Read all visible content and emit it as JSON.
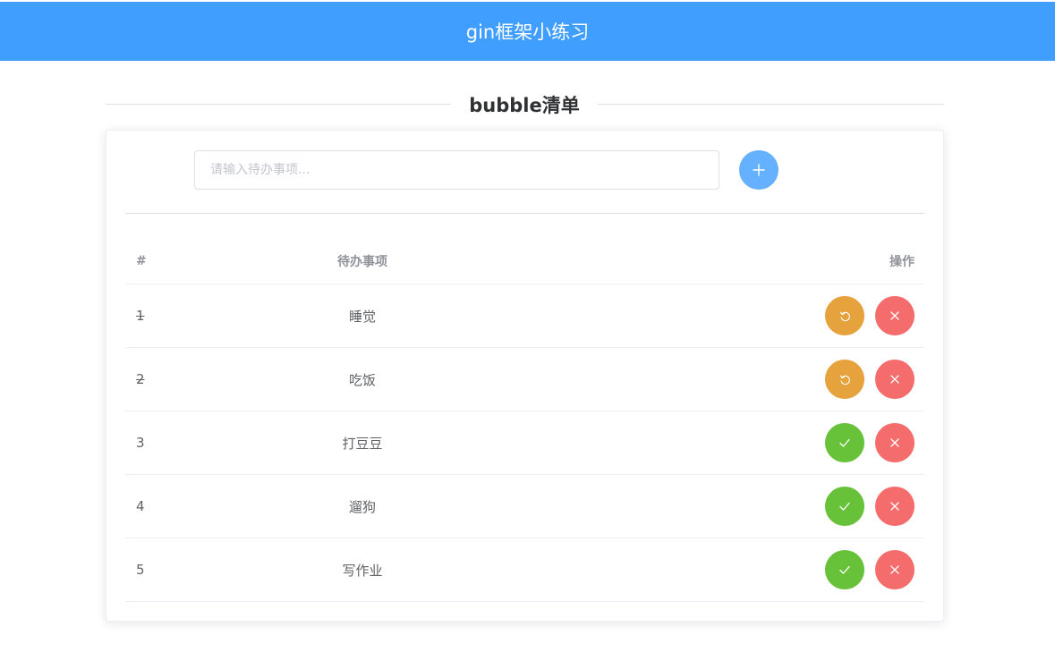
{
  "header": {
    "title": "gin框架小练习"
  },
  "section": {
    "title": "bubble清单"
  },
  "input": {
    "placeholder": "请输入待办事项...",
    "value": ""
  },
  "add_button": {
    "icon": "plus-icon"
  },
  "table": {
    "headers": {
      "index": "#",
      "title": "待办事项",
      "ops": "操作"
    },
    "rows": [
      {
        "index": "1",
        "title": "睡觉",
        "done": true
      },
      {
        "index": "2",
        "title": "吃饭",
        "done": true
      },
      {
        "index": "3",
        "title": "打豆豆",
        "done": false
      },
      {
        "index": "4",
        "title": "遛狗",
        "done": false
      },
      {
        "index": "5",
        "title": "写作业",
        "done": false
      }
    ]
  },
  "colors": {
    "primary": "#409eff",
    "add": "#66b1ff",
    "undo": "#e6a23c",
    "check": "#67c23a",
    "delete": "#f56c6c"
  }
}
